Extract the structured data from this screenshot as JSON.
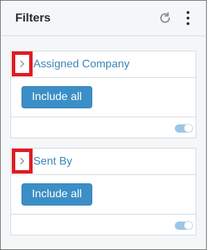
{
  "panel": {
    "title": "Filters",
    "icons": {
      "refresh": "refresh-icon",
      "more": "more-vertical-icon"
    }
  },
  "filters": [
    {
      "label": "Assigned Company",
      "button_label": "Include all",
      "toggle_on": true
    },
    {
      "label": "Sent By",
      "button_label": "Include all",
      "toggle_on": true
    }
  ],
  "colors": {
    "accent": "#3b8fc6",
    "title_link": "#3a86b8",
    "highlight": "#e11b22",
    "toggle_track": "#9cc6e6"
  }
}
